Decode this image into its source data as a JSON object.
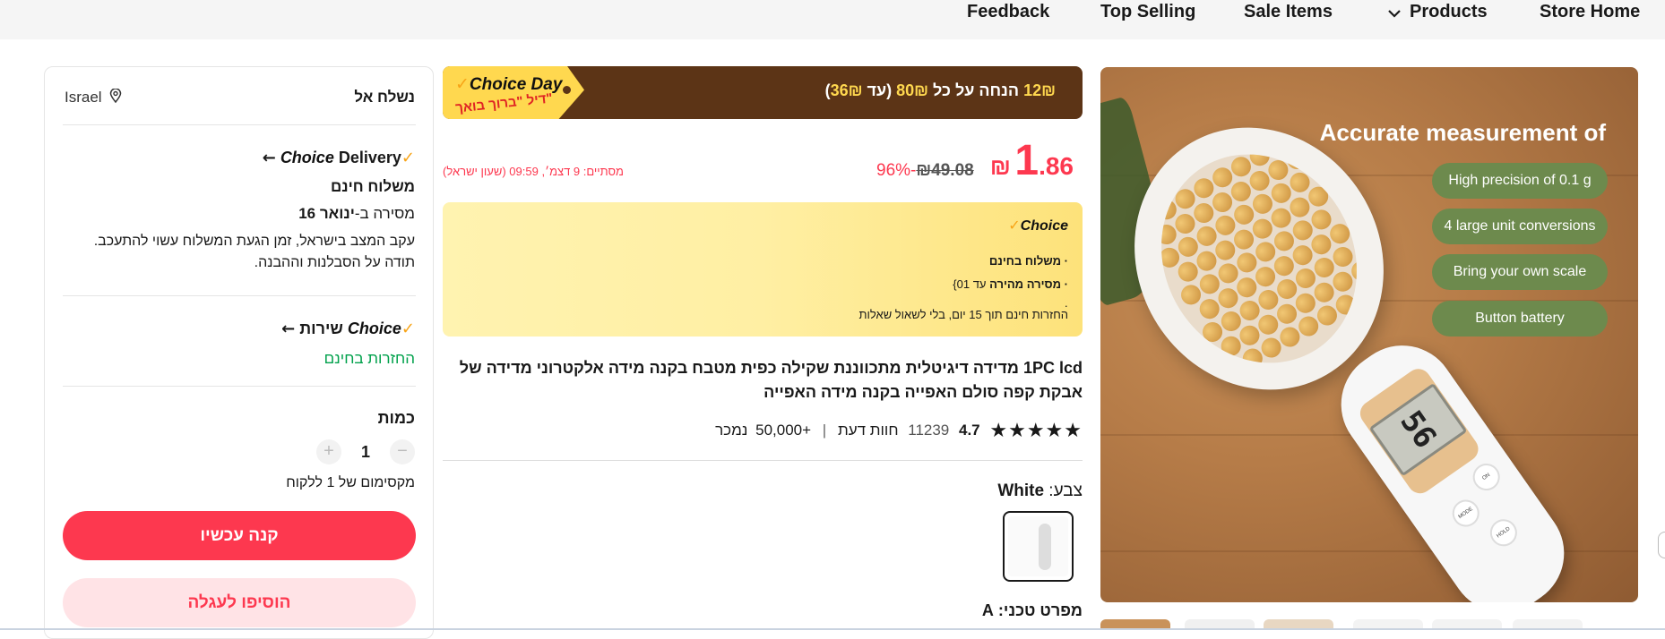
{
  "nav": {
    "feedback": "Feedback",
    "top_selling": "Top Selling",
    "sale_items": "Sale Items",
    "products": "Products",
    "store_home": "Store Home"
  },
  "gallery": {
    "headline": "Accurate measurement of",
    "features": [
      "High precision of 0.1 g",
      "4 large unit conversions",
      "Bring your own scale",
      "Button battery"
    ],
    "lcd_reading": "56"
  },
  "banner": {
    "choice_day": "Choice Day",
    "deal_text": "דיל \"ברוך בואך\"",
    "offer_amount": "12₪",
    "offer_text": " הנחה על כל ",
    "offer_threshold": "80₪",
    "offer_cap_prefix": " (עד ",
    "offer_cap": "36₪",
    "offer_cap_suffix": ")"
  },
  "price": {
    "currency": "₪",
    "whole": "1",
    "decimal": ".86",
    "discount": "96%-",
    "original": "₪49.08",
    "ends": "מסתיים: 9 דצמ׳, 09:59 (שעון ישראל)"
  },
  "choice_box": {
    "logo": "Choice",
    "line1": "· משלוח בחינם",
    "line2_bold": "· מסירה מהירה",
    "line2_rest": " עד 01}",
    "line3": "·",
    "line4": "החזרות חינם תוך 15 יום, בלי לשאול שאלות"
  },
  "product": {
    "title": "1PC lcd מדידה דיגיטלית מתכווננת שקילה כפית מטבח בקנה מידה אלקטרוני מדידה של אבקת קפה סולם האפייה בקנה מידה האפייה",
    "rating": "4.7",
    "reviews_count": "11239",
    "reviews_label": "חוות דעת",
    "sold": "+50,000",
    "sold_label": "נמכר",
    "stars": "★★★★★",
    "color_label": "צבע: ",
    "color_value": "White",
    "spec_label": "מפרט טכני: A"
  },
  "buybox": {
    "ship_to_label": "נשלח אל",
    "ship_to_country": "Israel",
    "delivery_label": "Delivery",
    "choice_logo": "Choice",
    "free_shipping": "משלוח חינם",
    "delivery_prefix": "מסירה ב-",
    "delivery_date": "ינואר 16",
    "notice_line1": "עקב המצב בישראל, זמן הגעת המשלוח עשוי להתעכב.",
    "notice_line2": "תודה על הסבלנות וההבנה.",
    "service_label": "שירות",
    "free_returns": "החזרות בחינם",
    "quantity_label": "כמות",
    "quantity_value": "1",
    "max_per_customer": "מקסימום של 1 ללקוח",
    "buy_now": "קנה עכשיו",
    "add_to_cart": "הוסיפו לעגלה"
  },
  "colors": {
    "accent": "#fd384f",
    "banner_bg": "#5c3416",
    "choice_yellow": "#ffd84f",
    "green_pill": "#6d8a4d",
    "returns_green": "#00a14b"
  }
}
